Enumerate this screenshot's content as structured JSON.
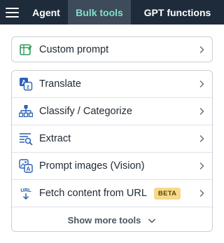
{
  "nav": {
    "tabs": [
      {
        "label": "Agent"
      },
      {
        "label": "Bulk tools"
      },
      {
        "label": "GPT functions"
      }
    ]
  },
  "custom": {
    "label": "Custom prompt"
  },
  "tools": [
    {
      "label": "Translate"
    },
    {
      "label": "Classify / Categorize"
    },
    {
      "label": "Extract"
    },
    {
      "label": "Prompt images (Vision)"
    },
    {
      "label": "Fetch content from URL",
      "badge": "BETA"
    }
  ],
  "show_more": {
    "label": "Show more tools"
  },
  "colors": {
    "topbar": "#1e2b3a",
    "active_tab_bg": "#3d4b5a",
    "active_tab_text": "#7fe3c6",
    "icon_blue": "#2b5fb3",
    "icon_green": "#2e9e57",
    "badge_bg": "#f7d98b"
  },
  "icons": [
    "menu-icon",
    "custom-prompt-icon",
    "translate-icon",
    "classify-icon",
    "extract-icon",
    "vision-icon",
    "url-icon",
    "chevron-right-icon",
    "chevron-down-icon"
  ]
}
